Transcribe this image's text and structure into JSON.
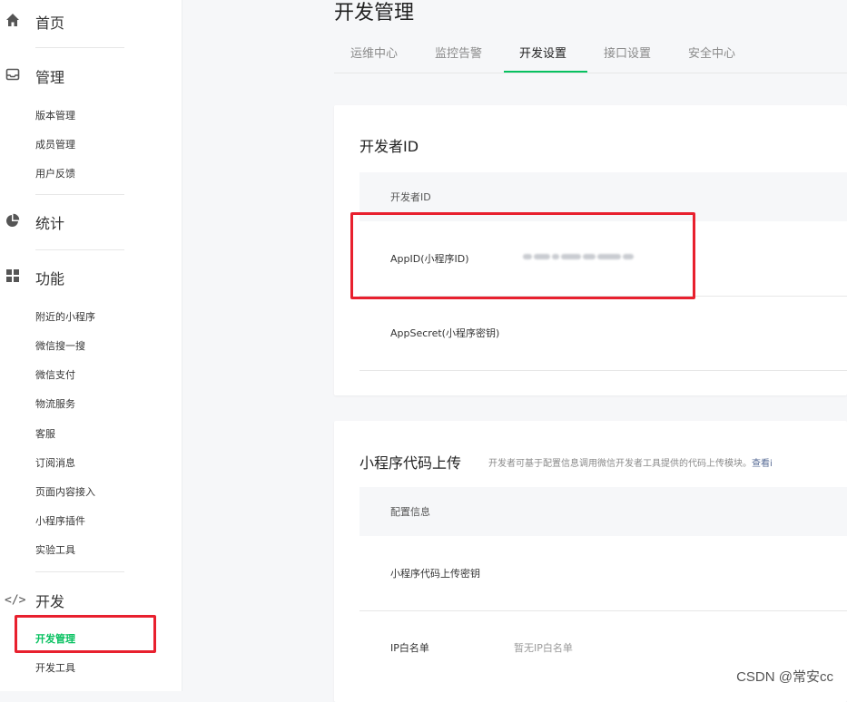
{
  "sidebar": {
    "home": {
      "label": "首页",
      "icon": "home-icon"
    },
    "manage": {
      "label": "管理",
      "icon": "inbox-icon",
      "items": [
        "版本管理",
        "成员管理",
        "用户反馈"
      ]
    },
    "stats": {
      "label": "统计",
      "icon": "pie-chart-icon"
    },
    "features": {
      "label": "功能",
      "icon": "grid-icon",
      "items": [
        "附近的小程序",
        "微信搜一搜",
        "微信支付",
        "物流服务",
        "客服",
        "订阅消息",
        "页面内容接入",
        "小程序插件",
        "实验工具"
      ]
    },
    "dev": {
      "label": "开发",
      "icon": "code-icon",
      "items": [
        "开发管理",
        "开发工具"
      ],
      "active": "开发管理"
    }
  },
  "page": {
    "title": "开发管理"
  },
  "tabs": [
    {
      "label": "运维中心"
    },
    {
      "label": "监控告警"
    },
    {
      "label": "开发设置",
      "active": true
    },
    {
      "label": "接口设置"
    },
    {
      "label": "安全中心"
    }
  ],
  "developer_card": {
    "title": "开发者ID",
    "table_header": "开发者ID",
    "rows": [
      {
        "key": "AppID(小程序ID)",
        "value_redacted": true
      },
      {
        "key": "AppSecret(小程序密钥)"
      }
    ]
  },
  "upload_card": {
    "title": "小程序代码上传",
    "desc": "开发者可基于配置信息调用微信开发者工具提供的代码上传模块。",
    "desc_link": "查看i",
    "table_header": "配置信息",
    "rows": [
      {
        "key": "小程序代码上传密钥"
      },
      {
        "key": "IP白名单",
        "value": "暂无IP白名单"
      }
    ]
  },
  "watermark": "CSDN @常安cc",
  "colors": {
    "accent": "#07c160",
    "highlight": "#e8202e",
    "link": "#576b95"
  }
}
